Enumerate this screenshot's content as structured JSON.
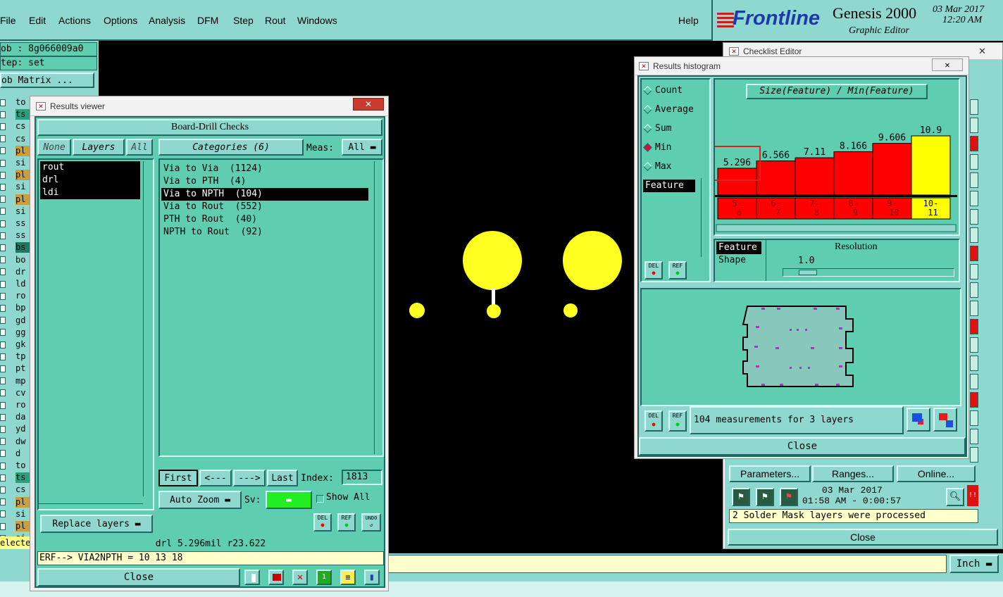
{
  "menubar": {
    "items": [
      "File",
      "Edit",
      "Actions",
      "Options",
      "Analysis",
      "DFM",
      "Step",
      "Rout",
      "Windows"
    ],
    "help": "Help"
  },
  "brand": {
    "logo": "Frontline",
    "product": "Genesis 2000",
    "subtitle": "Graphic Editor",
    "date": "03 Mar 2017",
    "time": "12:20 AM"
  },
  "left_panel": {
    "job": "ob : 8g066009a0",
    "step": "tep: set",
    "job_matrix": "ob Matrix ...",
    "layers": [
      "to",
      "ts",
      "cs",
      "cs",
      "pl",
      "si",
      "pl",
      "si",
      "pl",
      "si",
      "ss",
      "ss",
      "bs",
      "bo",
      "dr",
      "ld",
      "ro",
      "bp",
      "gd",
      "gg",
      "gk",
      "tp",
      "pt",
      "mp",
      "cv",
      "ro",
      "da",
      "yd",
      "dw",
      "d",
      "to",
      "ts",
      "cs",
      "pl",
      "si",
      "pl",
      "si"
    ],
    "selected": "elected"
  },
  "results_viewer": {
    "title": "Results viewer",
    "header": "Board-Drill Checks",
    "none_btn": "None",
    "layers_btn": "Layers",
    "all_btn": "All",
    "layers": [
      "rout",
      "drl",
      "ldi"
    ],
    "categories_btn": "Categories (6)",
    "meas_label": "Meas:",
    "meas_value": "All",
    "categories": [
      "Via to Via  (1124)",
      "Via to PTH  (4)",
      "Via to NPTH  (104)",
      "Via to Rout  (552)",
      "PTH to Rout  (40)",
      "NPTH to Rout  (92)"
    ],
    "selected_index": 2,
    "first": "First",
    "prev": "<---",
    "next": "--->",
    "last": "Last",
    "index_label": "Index:",
    "index_value": "1813",
    "auto_zoom": "Auto Zoom",
    "sv_label": "Sv:",
    "show_all": "Show All",
    "replace_layers": "Replace layers",
    "del": "DEL",
    "ref": "REF",
    "undo": "UNDO",
    "status": "drl  5.296mil  r23.622",
    "erf": "ERF--> VIA2NPTH = 10 13 18",
    "close": "Close"
  },
  "histogram": {
    "title": "Results histogram",
    "options": [
      "Count",
      "Average",
      "Sum",
      "Min",
      "Max"
    ],
    "selected_option": "Min",
    "chart_title": "Size(Feature) / Min(Feature)",
    "feature_list": [
      "Feature"
    ],
    "bars": [
      {
        "label": "5.296",
        "bin": "5-\n6",
        "value": 5.296,
        "color": "#ff0000"
      },
      {
        "label": "6.566",
        "bin": "6-\n7",
        "value": 6.566,
        "color": "#ff0000"
      },
      {
        "label": "7.11",
        "bin": "7-\n8",
        "value": 7.11,
        "color": "#ff0000"
      },
      {
        "label": "8.166",
        "bin": "8-\n9",
        "value": 8.166,
        "color": "#ff0000"
      },
      {
        "label": "9.606",
        "bin": "9-\n10",
        "value": 9.606,
        "color": "#ff0000"
      },
      {
        "label": "10.9",
        "bin": "10-\n11",
        "value": 10.9,
        "color": "#ffff00"
      }
    ],
    "group_list": [
      "Feature",
      "Shape"
    ],
    "resolution_label": "Resolution",
    "resolution_value": "1.0",
    "measurements": "104 measurements for 3 layers",
    "close": "Close"
  },
  "checklist": {
    "title": "Checklist Editor",
    "parameters": "Parameters...",
    "ranges": "Ranges...",
    "online": "Online...",
    "date": "03 Mar 2017",
    "time": "01:58 AM - 0:00:57",
    "message": "2 Solder Mask layers were processed",
    "close": "Close",
    "unit": "Inch"
  }
}
